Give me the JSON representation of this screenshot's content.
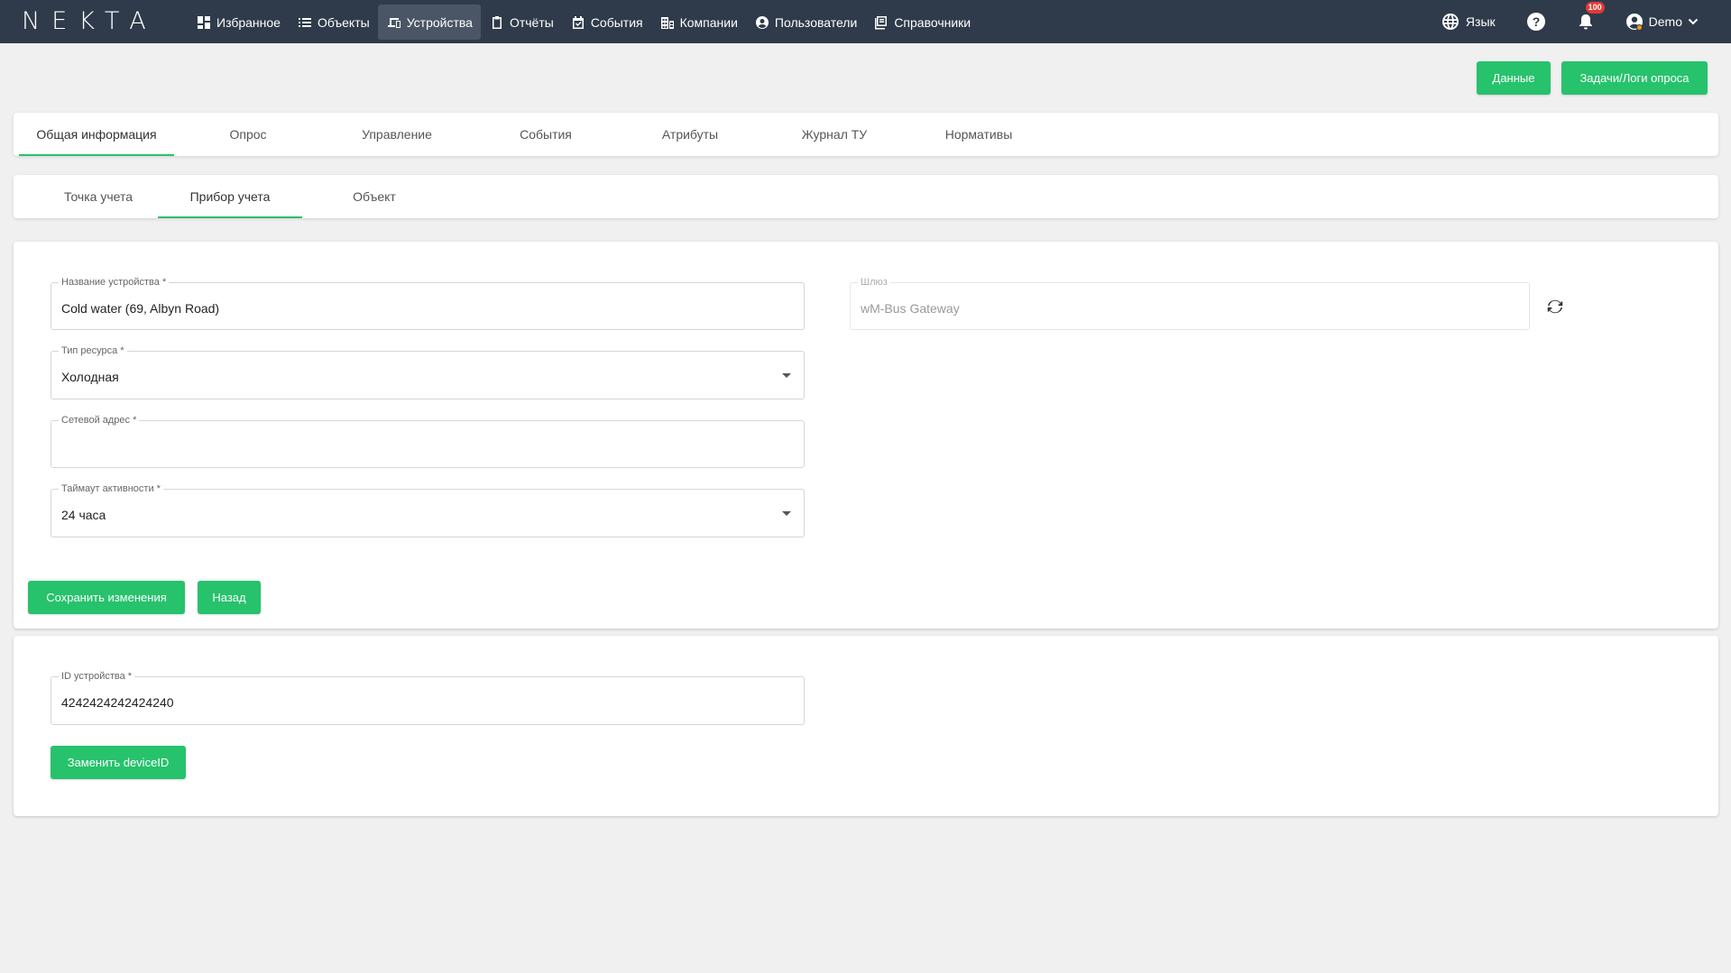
{
  "app": {
    "logo": "NEKTA"
  },
  "nav": {
    "items": [
      {
        "label": "Избранное",
        "icon": "dashboard-icon"
      },
      {
        "label": "Объекты",
        "icon": "list-icon"
      },
      {
        "label": "Устройства",
        "icon": "devices-icon",
        "active": true
      },
      {
        "label": "Отчёты",
        "icon": "clipboard-icon"
      },
      {
        "label": "События",
        "icon": "calendar-check-icon"
      },
      {
        "label": "Компании",
        "icon": "building-icon"
      },
      {
        "label": "Пользователи",
        "icon": "user-circle-icon"
      },
      {
        "label": "Справочники",
        "icon": "book-icon"
      }
    ],
    "language_label": "Язык",
    "notifications_count": "100",
    "user_name": "Demo"
  },
  "actions": {
    "data_label": "Данные",
    "tasks_label": "Задачи/Логи опроса"
  },
  "main_tabs": [
    {
      "label": "Общая информация",
      "active": true
    },
    {
      "label": "Опрос"
    },
    {
      "label": "Управление"
    },
    {
      "label": "События"
    },
    {
      "label": "Атрибуты"
    },
    {
      "label": "Журнал ТУ"
    },
    {
      "label": "Нормативы"
    }
  ],
  "sub_tabs": [
    {
      "label": "Точка учета"
    },
    {
      "label": "Прибор учета",
      "active": true
    },
    {
      "label": "Объект"
    }
  ],
  "form": {
    "device_name": {
      "label": "Название устройства *",
      "value": "Cold water (69, Albyn Road)"
    },
    "resource_type": {
      "label": "Тип ресурса *",
      "value": "Холодная"
    },
    "network_address": {
      "label": "Сетевой адрес *",
      "value": ""
    },
    "activity_timeout": {
      "label": "Таймаут активности *",
      "value": "24 часа"
    },
    "gateway": {
      "label": "Шлюз",
      "value": "wM-Bus Gateway"
    },
    "save_label": "Сохранить изменения",
    "back_label": "Назад"
  },
  "device_id": {
    "label": "ID устройства *",
    "value": "4242424242424240",
    "replace_label": "Заменить deviceID"
  },
  "colors": {
    "topbar": "#2f3b4a",
    "accent": "#27c26c",
    "background": "#f0f0f0"
  }
}
